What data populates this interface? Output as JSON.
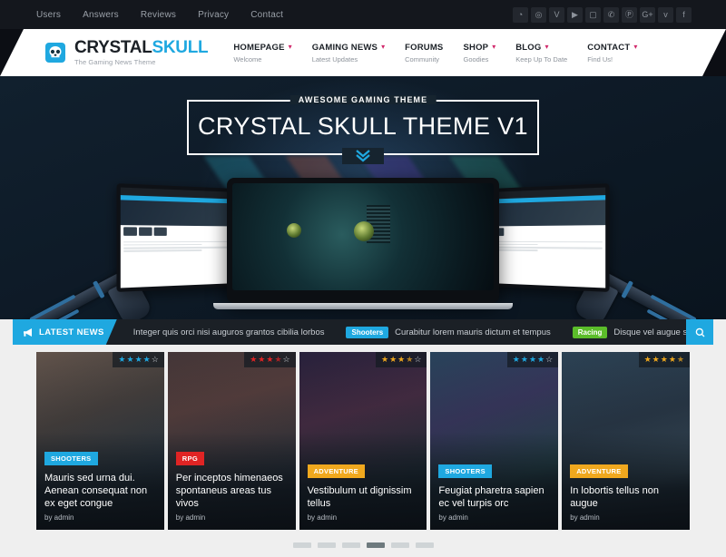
{
  "topbar": {
    "links": [
      {
        "label": "Users"
      },
      {
        "label": "Answers"
      },
      {
        "label": "Reviews"
      },
      {
        "label": "Privacy"
      },
      {
        "label": "Contact"
      }
    ],
    "social": [
      {
        "name": "rss-icon",
        "glyph": "◔"
      },
      {
        "name": "dribbble-icon",
        "glyph": "◎"
      },
      {
        "name": "vimeo-icon",
        "glyph": "V"
      },
      {
        "name": "youtube-icon",
        "glyph": "▶"
      },
      {
        "name": "comments-icon",
        "glyph": "▢"
      },
      {
        "name": "phone-icon",
        "glyph": "✆"
      },
      {
        "name": "pinterest-icon",
        "glyph": "Ⓟ"
      },
      {
        "name": "google-plus-icon",
        "glyph": "G+"
      },
      {
        "name": "twitter-icon",
        "glyph": "ᴠ"
      },
      {
        "name": "facebook-icon",
        "glyph": "f"
      }
    ]
  },
  "header": {
    "logo": {
      "name_part1": "CRYSTAL",
      "name_part2": "SKULL",
      "tagline": "The Gaming News Theme"
    },
    "nav": [
      {
        "label": "HOMEPAGE",
        "sub": "Welcome",
        "caret": true
      },
      {
        "label": "GAMING NEWS",
        "sub": "Latest Updates",
        "caret": true
      },
      {
        "label": "FORUMS",
        "sub": "Community",
        "caret": false
      },
      {
        "label": "SHOP",
        "sub": "Goodies",
        "caret": true
      },
      {
        "label": "BLOG",
        "sub": "Keep Up To Date",
        "caret": true
      },
      {
        "label": "CONTACT",
        "sub": "Find Us!",
        "caret": true
      }
    ]
  },
  "hero": {
    "caption": "AWESOME GAMING THEME",
    "title": "CRYSTAL SKULL THEME V1",
    "scroll_chevrons": "⌄"
  },
  "ticker": {
    "label": "LATEST NEWS",
    "megaphone": "📣",
    "items": [
      {
        "badge": "",
        "badge_color": "",
        "text": "Integer quis orci nisi auguros grantos cibilia lorbos"
      },
      {
        "badge": "Shooters",
        "badge_color": "#1fa8e0",
        "text": "Curabitur lorem mauris dictum et tempus"
      },
      {
        "badge": "Racing",
        "badge_color": "#5bbd2a",
        "text": "Disque vel augue sit amet diam lob"
      }
    ]
  },
  "cards": [
    {
      "category": "SHOOTERS",
      "category_color": "#1fa8e0",
      "title": "Mauris sed urna dui. Aenean consequat non ex eget congue",
      "author": "by admin",
      "rating": 4,
      "rating_half": false,
      "star_color": "#1fa8e0"
    },
    {
      "category": "RPG",
      "category_color": "#e02424",
      "title": "Per inceptos himenaeos spontaneus areas tus vivos",
      "author": "by admin",
      "rating": 3,
      "rating_half": true,
      "star_color": "#e02424"
    },
    {
      "category": "ADVENTURE",
      "category_color": "#f0a81e",
      "title": "Vestibulum ut dignissim tellus",
      "author": "by admin",
      "rating": 3,
      "rating_half": true,
      "star_color": "#f0a81e"
    },
    {
      "category": "SHOOTERS",
      "category_color": "#1fa8e0",
      "title": "Feugiat pharetra sapien ec vel turpis orc",
      "author": "by admin",
      "rating": 4,
      "rating_half": false,
      "star_color": "#1fa8e0"
    },
    {
      "category": "ADVENTURE",
      "category_color": "#f0a81e",
      "title": "In lobortis tellus non augue",
      "author": "by admin",
      "rating": 4,
      "rating_half": true,
      "star_color": "#f0a81e"
    }
  ],
  "pagination": {
    "count": 6,
    "active_index": 3
  },
  "colors": {
    "accent": "#1fa8e0",
    "topbar_bg": "#14171d",
    "caret": "#d1286a"
  }
}
